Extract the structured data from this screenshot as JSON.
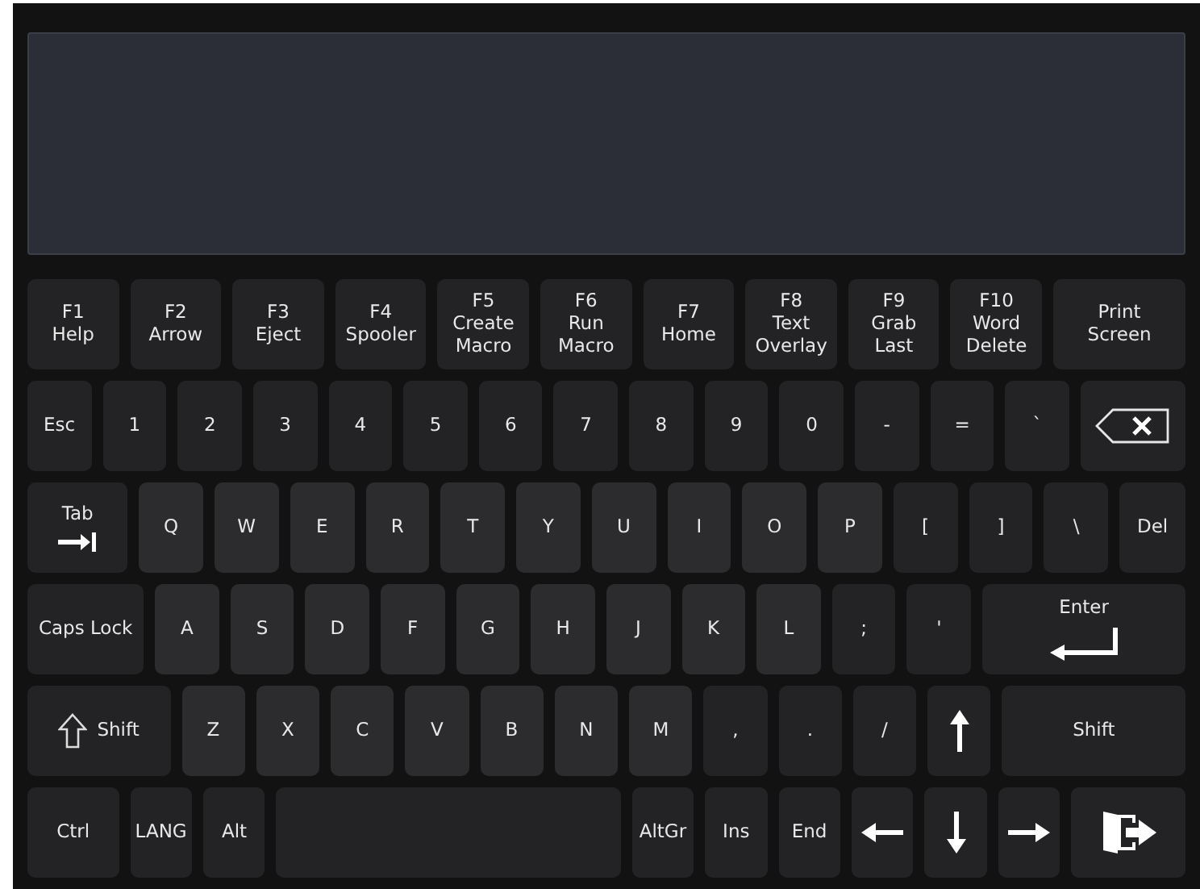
{
  "keyboard": {
    "function_row": [
      {
        "kind": "func",
        "label": "F1\nHelp"
      },
      {
        "kind": "func",
        "label": "F2\nArrow"
      },
      {
        "kind": "func",
        "label": "F3\nEject"
      },
      {
        "kind": "func",
        "label": "F4\nSpooler"
      },
      {
        "kind": "func",
        "label": "F5\nCreate\nMacro"
      },
      {
        "kind": "func",
        "label": "F6\nRun\nMacro"
      },
      {
        "kind": "func",
        "label": "F7\nHome"
      },
      {
        "kind": "func",
        "label": "F8\nText\nOverlay"
      },
      {
        "kind": "func",
        "label": "F9\nGrab\nLast"
      },
      {
        "kind": "func",
        "label": "F10\nWord\nDelete"
      },
      {
        "kind": "func",
        "label": "Print\nScreen"
      }
    ],
    "number_row": [
      {
        "kind": "func",
        "label": "Esc"
      },
      {
        "kind": "func",
        "label": "1"
      },
      {
        "kind": "func",
        "label": "2"
      },
      {
        "kind": "func",
        "label": "3"
      },
      {
        "kind": "func",
        "label": "4"
      },
      {
        "kind": "func",
        "label": "5"
      },
      {
        "kind": "func",
        "label": "6"
      },
      {
        "kind": "func",
        "label": "7"
      },
      {
        "kind": "func",
        "label": "8"
      },
      {
        "kind": "func",
        "label": "9"
      },
      {
        "kind": "func",
        "label": "0"
      },
      {
        "kind": "func",
        "label": "-"
      },
      {
        "kind": "func",
        "label": "="
      },
      {
        "kind": "func",
        "label": "`"
      },
      {
        "kind": "backspace"
      }
    ],
    "top_letter_row": [
      {
        "kind": "tab",
        "label": "Tab"
      },
      {
        "kind": "char",
        "label": "Q"
      },
      {
        "kind": "char",
        "label": "W"
      },
      {
        "kind": "char",
        "label": "E"
      },
      {
        "kind": "char",
        "label": "R"
      },
      {
        "kind": "char",
        "label": "T"
      },
      {
        "kind": "char",
        "label": "Y"
      },
      {
        "kind": "char",
        "label": "U"
      },
      {
        "kind": "char",
        "label": "I"
      },
      {
        "kind": "char",
        "label": "O"
      },
      {
        "kind": "char",
        "label": "P"
      },
      {
        "kind": "func",
        "label": "["
      },
      {
        "kind": "func",
        "label": "]"
      },
      {
        "kind": "func",
        "label": "\\"
      },
      {
        "kind": "func",
        "label": "Del"
      }
    ],
    "home_row": [
      {
        "kind": "func",
        "label": "Caps Lock"
      },
      {
        "kind": "char",
        "label": "A"
      },
      {
        "kind": "char",
        "label": "S"
      },
      {
        "kind": "char",
        "label": "D"
      },
      {
        "kind": "char",
        "label": "F"
      },
      {
        "kind": "char",
        "label": "G"
      },
      {
        "kind": "char",
        "label": "H"
      },
      {
        "kind": "char",
        "label": "J"
      },
      {
        "kind": "char",
        "label": "K"
      },
      {
        "kind": "char",
        "label": "L"
      },
      {
        "kind": "func",
        "label": ";"
      },
      {
        "kind": "func",
        "label": "'"
      },
      {
        "kind": "enter",
        "label": "Enter"
      }
    ],
    "bottom_letter_row": [
      {
        "kind": "shift",
        "label": "Shift"
      },
      {
        "kind": "char",
        "label": "Z"
      },
      {
        "kind": "char",
        "label": "X"
      },
      {
        "kind": "char",
        "label": "C"
      },
      {
        "kind": "char",
        "label": "V"
      },
      {
        "kind": "char",
        "label": "B"
      },
      {
        "kind": "char",
        "label": "N"
      },
      {
        "kind": "char",
        "label": "M"
      },
      {
        "kind": "func",
        "label": ","
      },
      {
        "kind": "func",
        "label": "."
      },
      {
        "kind": "func",
        "label": "/"
      },
      {
        "kind": "up"
      },
      {
        "kind": "func",
        "label": "Shift"
      }
    ],
    "control_row": [
      {
        "kind": "func",
        "label": "Ctrl"
      },
      {
        "kind": "func",
        "label": "LANG"
      },
      {
        "kind": "func",
        "label": "Alt"
      },
      {
        "kind": "space"
      },
      {
        "kind": "func",
        "label": "AltGr"
      },
      {
        "kind": "func",
        "label": "Ins"
      },
      {
        "kind": "func",
        "label": "End"
      },
      {
        "kind": "left"
      },
      {
        "kind": "down"
      },
      {
        "kind": "right"
      },
      {
        "kind": "exit"
      }
    ]
  }
}
